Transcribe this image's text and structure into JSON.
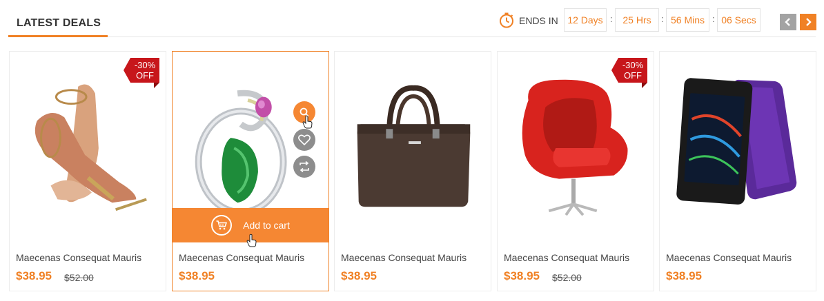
{
  "header": {
    "title": "LATEST DEALS",
    "ends_in": "ENDS IN",
    "countdown": {
      "days": "12 Days",
      "hours": "25 Hrs",
      "mins": "56 Mins",
      "secs": "06 Secs",
      "sep": ":"
    }
  },
  "colors": {
    "accent": "#f08125",
    "sale_badge": "#c7161b",
    "nav_inactive": "#a3a3a3"
  },
  "icons": [
    "timer-icon",
    "chevron-left-icon",
    "chevron-right-icon",
    "search-icon",
    "heart-icon",
    "compare-icon",
    "cart-icon",
    "hand-cursor-icon"
  ],
  "products": [
    {
      "name": "Maecenas Consequat Mauris",
      "price": "$38.95",
      "old_price": "$52.00",
      "badge": [
        "-30%",
        "OFF"
      ],
      "image": "high-heel-sandal"
    },
    {
      "name": "Maecenas Consequat Mauris",
      "price": "$38.95",
      "image": "emerald-ring",
      "add_to_cart": "Add to cart"
    },
    {
      "name": "Maecenas Consequat Mauris",
      "price": "$38.95",
      "image": "leather-handbag"
    },
    {
      "name": "Maecenas Consequat Mauris",
      "price": "$38.95",
      "old_price": "$52.00",
      "badge": [
        "-30%",
        "OFF"
      ],
      "image": "red-egg-chair"
    },
    {
      "name": "Maecenas Consequat Mauris",
      "price": "$38.95",
      "image": "xperia-smartphone"
    }
  ]
}
